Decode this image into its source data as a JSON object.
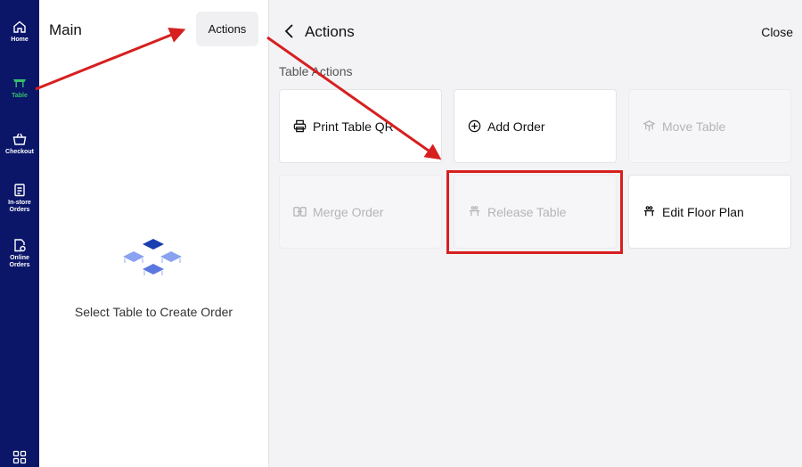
{
  "sidebar": {
    "items": [
      {
        "label": "Home",
        "icon": "home-icon",
        "active": false
      },
      {
        "label": "Table",
        "icon": "table-icon",
        "active": true
      },
      {
        "label": "Checkout",
        "icon": "basket-icon",
        "active": false
      },
      {
        "label": "In-store\nOrders",
        "icon": "clipboard-icon",
        "active": false
      },
      {
        "label": "Online\nOrders",
        "icon": "online-orders-icon",
        "active": false
      }
    ],
    "bottom_icon": "grid-icon"
  },
  "main": {
    "title": "Main",
    "actions_label": "Actions",
    "empty_text": "Select Table to Create Order"
  },
  "actions_panel": {
    "title": "Actions",
    "close_label": "Close",
    "section_label": "Table Actions",
    "buttons": [
      {
        "label": "Print Table QR",
        "icon": "printer-icon",
        "enabled": true
      },
      {
        "label": "Add Order",
        "icon": "plus-circle-icon",
        "enabled": true
      },
      {
        "label": "Move Table",
        "icon": "move-table-icon",
        "enabled": false
      },
      {
        "label": "Merge Order",
        "icon": "merge-icon",
        "enabled": false
      },
      {
        "label": "Release Table",
        "icon": "release-table-icon",
        "enabled": false
      },
      {
        "label": "Edit Floor Plan",
        "icon": "floor-plan-icon",
        "enabled": true
      }
    ]
  },
  "colors": {
    "sidebar_bg": "#0b1669",
    "active_nav": "#35c06b",
    "annotation_red": "#d71f1f",
    "panel_bg": "#f3f3f6"
  }
}
